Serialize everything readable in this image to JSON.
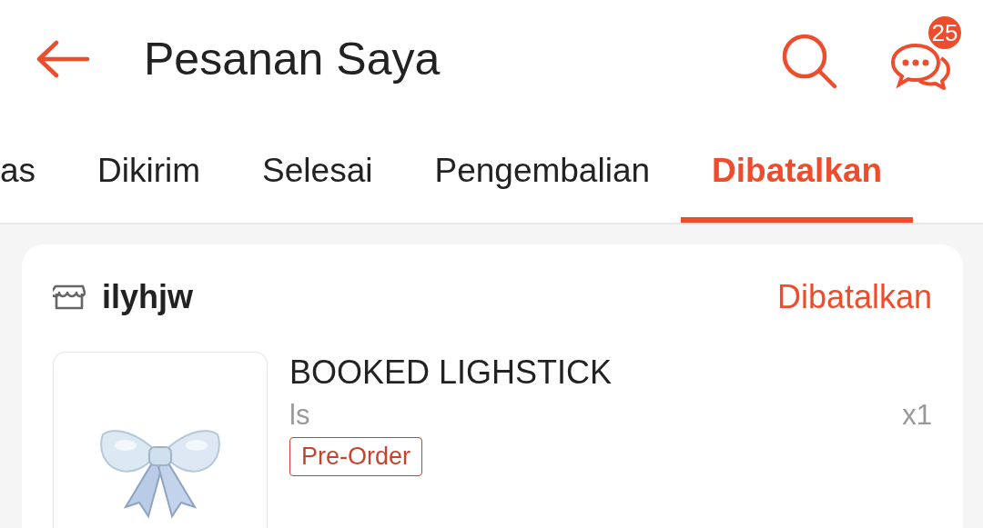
{
  "header": {
    "title": "Pesanan Saya",
    "chat_badge": "25"
  },
  "tabs": [
    {
      "label": "as",
      "selected": false
    },
    {
      "label": "Dikirim",
      "selected": false
    },
    {
      "label": "Selesai",
      "selected": false
    },
    {
      "label": "Pengembalian",
      "selected": false
    },
    {
      "label": "Dibatalkan",
      "selected": true
    }
  ],
  "orders": [
    {
      "shop": "ilyhjw",
      "status": "Dibatalkan",
      "product": {
        "kind": "picture",
        "name": "BOOKED LIGHSTICK",
        "variant": "ls",
        "quantity": "x1",
        "tag": "Pre-Order"
      }
    }
  ]
}
